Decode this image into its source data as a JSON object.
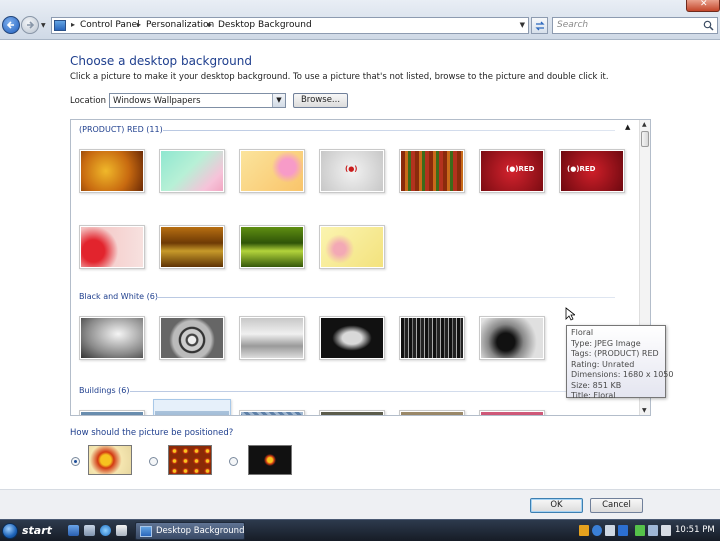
{
  "address_bar": {
    "crumbs": [
      "Control Panel",
      "Personalization",
      "Desktop Background"
    ],
    "search_placeholder": "Search"
  },
  "main": {
    "title": "Choose a desktop background",
    "description": "Click a picture to make it your desktop background. To use a picture that's not listed, browse to the picture and double click it.",
    "location_label": "Location",
    "location_value": "Windows Wallpapers",
    "browse_label": "Browse...",
    "position_question": "How should the picture be positioned?"
  },
  "gallery": {
    "groups": [
      {
        "header": "(PRODUCT) RED (11)"
      },
      {
        "header": "Black and White (6)"
      },
      {
        "header": "Buildings (6)"
      }
    ],
    "product_red_thumb_labels": [
      "(●)",
      "(●)RED",
      "(●)RED"
    ]
  },
  "tooltip": {
    "lines": [
      "Floral",
      "Type: JPEG Image",
      "Tags: (PRODUCT) RED",
      "Rating: Unrated",
      "Dimensions: 1680 x 1050",
      "Size: 851 KB",
      "Title: Floral"
    ]
  },
  "position_options": [
    {
      "name": "fit-to-screen",
      "selected": true
    },
    {
      "name": "tile",
      "selected": false
    },
    {
      "name": "center",
      "selected": false
    }
  ],
  "buttons": {
    "ok": "OK",
    "cancel": "Cancel"
  },
  "taskbar": {
    "start": "start",
    "task_label": "Desktop Background",
    "clock": "10:51 PM"
  }
}
